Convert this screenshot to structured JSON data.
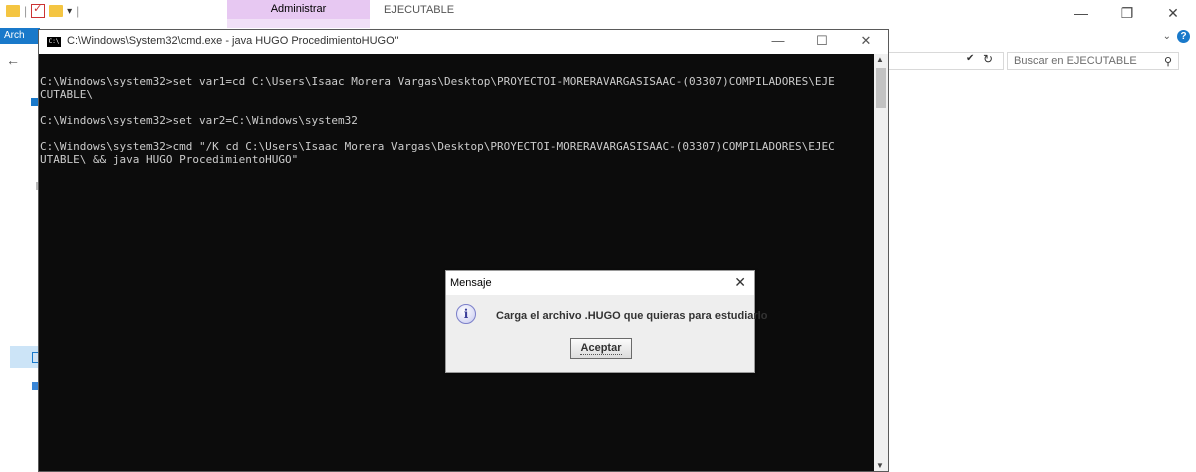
{
  "explorer": {
    "ribbon_context_label": "Administrar",
    "window_title": "EJECUTABLE",
    "file_tab_label": "Arch",
    "search_placeholder": "Buscar en EJECUTABLE",
    "controls": {
      "minimize": "—",
      "restore": "❐",
      "close": "✕"
    }
  },
  "cmd": {
    "title": "C:\\Windows\\System32\\cmd.exe - java  HUGO ProcedimientoHUGO\"",
    "lines": [
      "C:\\Windows\\system32>set var1=cd C:\\Users\\Isaac Morera Vargas\\Desktop\\PROYECTOI-MORERAVARGASISAAC-(03307)COMPILADORES\\EJE",
      "CUTABLE\\",
      "",
      "C:\\Windows\\system32>set var2=C:\\Windows\\system32",
      "",
      "C:\\Windows\\system32>cmd \"/K cd C:\\Users\\Isaac Morera Vargas\\Desktop\\PROYECTOI-MORERAVARGASISAAC-(03307)COMPILADORES\\EJEC",
      "UTABLE\\ && java HUGO ProcedimientoHUGO\""
    ]
  },
  "dialog": {
    "title": "Mensaje",
    "message": "Carga el archivo .HUGO que quieras para estudiarlo",
    "button_label": "Aceptar",
    "icon": "info-icon"
  }
}
